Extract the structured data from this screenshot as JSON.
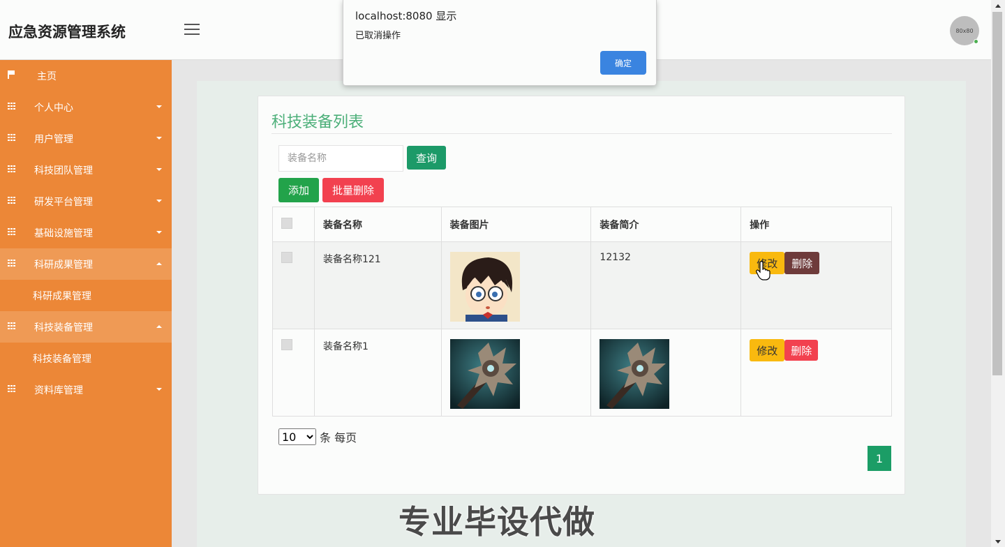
{
  "header": {
    "brand": "应急资源管理系统",
    "avatar_text": "80x80"
  },
  "sidebar": {
    "items": [
      {
        "label": "主页",
        "icon": "flag-icon"
      },
      {
        "label": "个人中心",
        "icon": "grid-icon"
      },
      {
        "label": "用户管理",
        "icon": "grid-icon"
      },
      {
        "label": "科技团队管理",
        "icon": "grid-icon"
      },
      {
        "label": "研发平台管理",
        "icon": "grid-icon"
      },
      {
        "label": "基础设施管理",
        "icon": "grid-icon"
      },
      {
        "label": "科研成果管理",
        "icon": "grid-icon",
        "sub": "科研成果管理"
      },
      {
        "label": "科技装备管理",
        "icon": "grid-icon",
        "sub": "科技装备管理"
      },
      {
        "label": "资料库管理",
        "icon": "grid-icon"
      }
    ]
  },
  "main": {
    "title": "科技装备列表",
    "search_placeholder": "装备名称",
    "query_label": "查询",
    "add_label": "添加",
    "batch_delete_label": "批量删除",
    "columns": [
      "装备名称",
      "装备图片",
      "装备简介",
      "操作"
    ],
    "rows": [
      {
        "name": "装备名称121",
        "image": "anime-boy-with-glasses",
        "intro": "12132",
        "intro_is_image": false,
        "edit": "修改",
        "delete": "删除"
      },
      {
        "name": "装备名称1",
        "image": "spiked-mace-weapon",
        "intro": "spiked-mace-weapon",
        "intro_is_image": true,
        "edit": "修改",
        "delete": "删除"
      }
    ],
    "page_size": "10",
    "page_size_suffix": "条 每页",
    "current_page": "1"
  },
  "watermark": "专业毕设代做",
  "dialog": {
    "title": "localhost:8080 显示",
    "message": "已取消操作",
    "ok_label": "确定"
  },
  "colors": {
    "sidebar": "#ec8737",
    "title_green": "#4caf79",
    "query_btn": "#1c9a68",
    "add_btn": "#22a34a",
    "batch_delete_btn": "#f2414f",
    "edit_btn": "#f9b90f",
    "dialog_ok": "#3a84e0"
  }
}
